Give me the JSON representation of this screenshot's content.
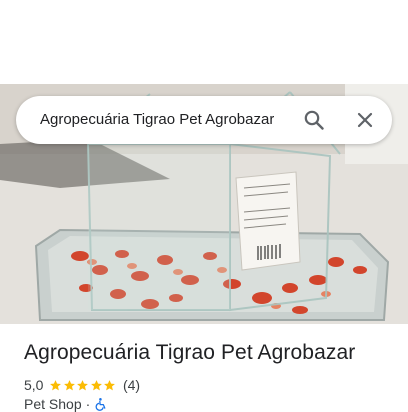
{
  "search": {
    "query": "Agropecuária Tigrao Pet Agrobazar",
    "search_icon": "search-icon",
    "close_icon": "close-icon"
  },
  "place": {
    "name": "Agropecuária Tigrao Pet Agrobazar",
    "rating": "5,0",
    "stars": 5,
    "review_count": "(4)",
    "category": "Pet Shop",
    "separator": "·",
    "accessibility_icon": "wheelchair-icon"
  },
  "colors": {
    "star": "#fbbc04",
    "accessibility": "#1a73e8",
    "icon_gray": "#5f6368",
    "text": "#202124"
  }
}
